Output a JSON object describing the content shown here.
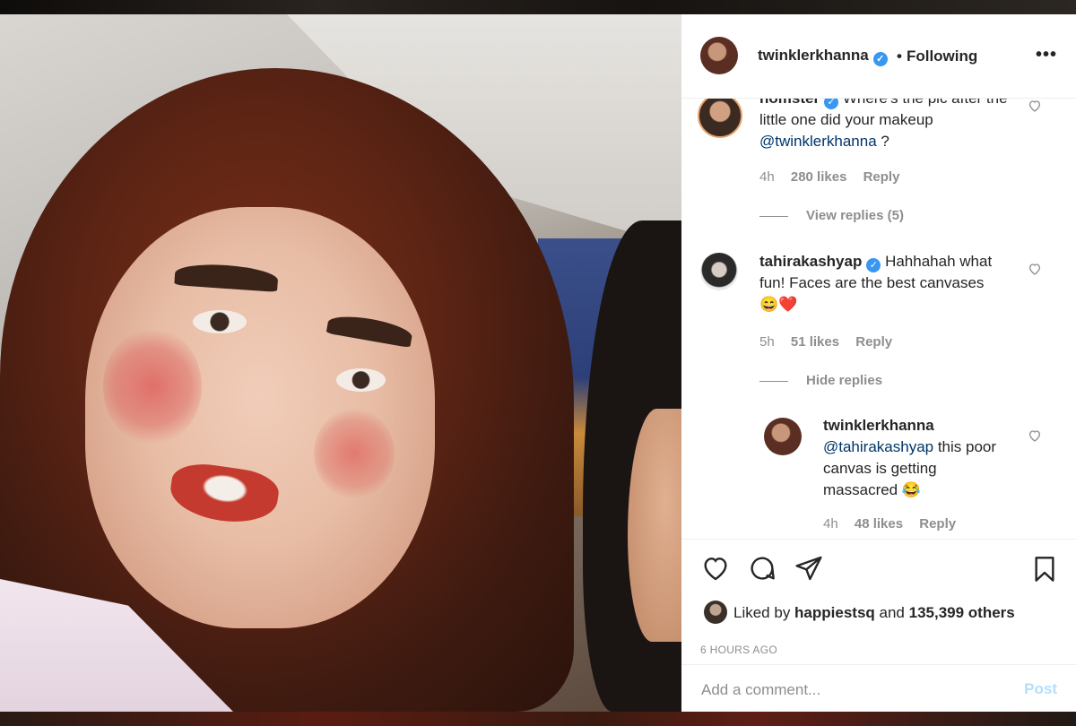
{
  "post": {
    "username": "twinklerkhanna",
    "separator": "•",
    "follow_status": "Following",
    "more_label": "•••"
  },
  "comments": [
    {
      "username": "nomster",
      "text": "Where's the pic after the little one did your makeup",
      "mention": "@twinklerkhanna",
      "tail": " ?",
      "time": "4h",
      "likes": "280 likes",
      "reply": "Reply",
      "replies_toggle": "View replies (5)"
    },
    {
      "username": "tahirakashyap",
      "text": "Hahhahah what fun! Faces are the best canvases",
      "emoji": "😄❤️",
      "time": "5h",
      "likes": "51 likes",
      "reply": "Reply",
      "replies_toggle": "Hide replies"
    }
  ],
  "reply": {
    "username": "twinklerkhanna",
    "mention": "@tahirakashyap",
    "text": " this poor canvas is getting massacred",
    "emoji": "😂",
    "time": "4h",
    "likes": "48 likes",
    "reply": "Reply"
  },
  "likes_summary": {
    "prefix": "Liked by ",
    "user": "happiestsq",
    "middle": " and ",
    "count": "135,399 others"
  },
  "time_ago": "6 HOURS AGO",
  "comment_box": {
    "placeholder": "Add a comment...",
    "post_label": "Post"
  },
  "colors": {
    "verified": "#3897f0",
    "post_button_disabled": "#b2dffc",
    "mention": "#003569"
  },
  "icons": [
    "heart-icon",
    "comment-icon",
    "share-icon",
    "bookmark-icon",
    "verified-icon",
    "more-icon"
  ]
}
